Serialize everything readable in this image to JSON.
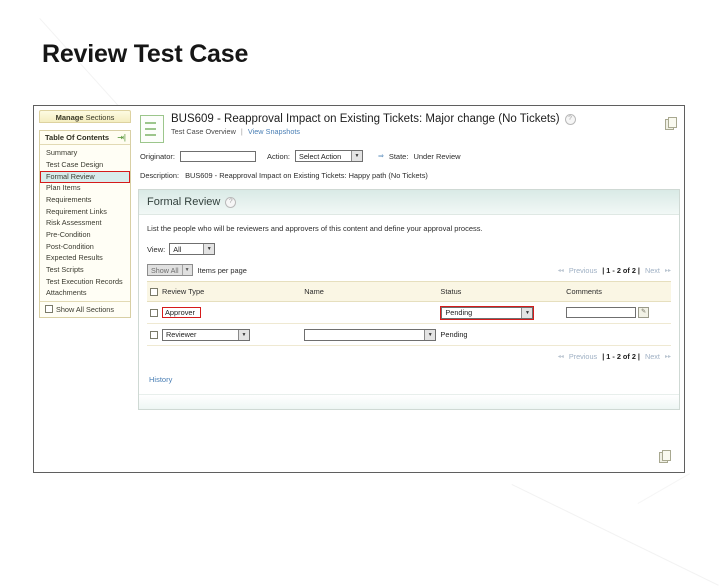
{
  "slide": {
    "title": "Review Test Case"
  },
  "sidebar": {
    "manage_tab_bold": "Manage",
    "manage_tab_thin": "Sections",
    "toc_header": "Table Of Contents",
    "collapse_icon": "collapse-icon",
    "items": [
      "Summary",
      "Test Case Design",
      "Formal Review",
      "Plan Items",
      "Requirements",
      "Requirement Links",
      "Risk Assessment",
      "Pre-Condition",
      "Post-Condition",
      "Expected Results",
      "Test Scripts",
      "Test Execution Records",
      "Attachments"
    ],
    "show_all_sections": "Show All Sections"
  },
  "document": {
    "icon": "document-icon",
    "title": "BUS609 - Reapproval Impact on Existing Tickets: Major change (No Tickets)",
    "help_icon": "?",
    "subnav_current": "Test Case Overview",
    "subnav_separator": "|",
    "subnav_link": "View Snapshots",
    "copy_icon": "copy-icon",
    "originator_label": "Originator:",
    "originator_value": "",
    "action_label": "Action:",
    "action_value": "Select Action",
    "state_arrow": "⇒",
    "state_label": "State:",
    "state_value": "Under Review",
    "description_label": "Description:",
    "description_value": "BUS609 - Reapproval Impact on Existing Tickets: Happy path (No Tickets)"
  },
  "panel": {
    "title": "Formal Review",
    "help_icon": "?",
    "description": "List the people who will be reviewers and approvers of this content and define your approval process.",
    "view_label": "View:",
    "view_value": "All",
    "show_all_button": "Show All",
    "items_per_page_label": "Items per page",
    "history_link": "History"
  },
  "pager": {
    "first": "◂◂",
    "previous": "Previous",
    "count": "| 1 - 2 of 2 |",
    "next": "Next",
    "last": "▸▸"
  },
  "table": {
    "headers": [
      "Review Type",
      "Name",
      "Status",
      "Comments"
    ],
    "rows": [
      {
        "review_type": "Approver",
        "review_type_is_select": false,
        "name": "",
        "name_is_select": false,
        "status": "Pending",
        "status_is_select": true,
        "comments": "",
        "has_comment_input": true
      },
      {
        "review_type": "Reviewer",
        "review_type_is_select": true,
        "name": "",
        "name_is_select": true,
        "status": "Pending",
        "status_is_select": false,
        "comments": "",
        "has_comment_input": false
      }
    ]
  },
  "annotations": {
    "highlight_color": "#d51b1b",
    "targets": [
      "Formal Review",
      "Approver",
      "Pending"
    ]
  }
}
